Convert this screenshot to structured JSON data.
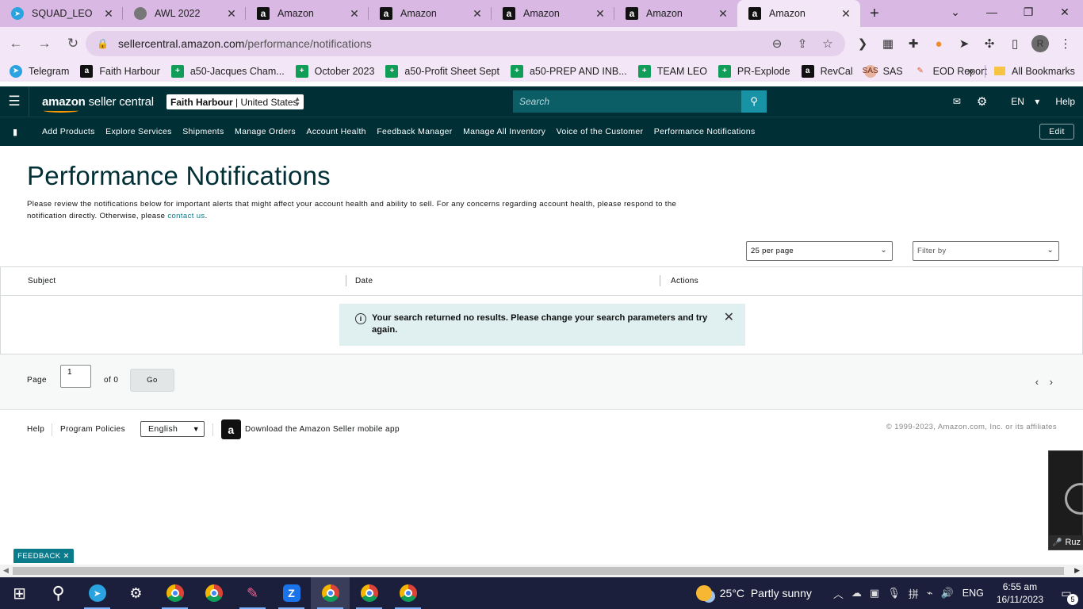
{
  "browser": {
    "tabs": [
      {
        "title": "SQUAD_LEO",
        "icon": "telegram-icon"
      },
      {
        "title": "AWL 2022",
        "icon": "globe-icon"
      },
      {
        "title": "Amazon",
        "icon": "amazon-icon"
      },
      {
        "title": "Amazon",
        "icon": "amazon-icon"
      },
      {
        "title": "Amazon",
        "icon": "amazon-icon"
      },
      {
        "title": "Amazon",
        "icon": "amazon-icon"
      },
      {
        "title": "Amazon",
        "icon": "amazon-icon",
        "active": true
      }
    ],
    "url_host": "sellercentral.amazon.com",
    "url_path": "/performance/notifications",
    "profile_initial": "R",
    "bookmarks": [
      {
        "label": "Telegram",
        "icon": "telegram"
      },
      {
        "label": "Faith Harbour",
        "icon": "amazon"
      },
      {
        "label": "a50-Jacques Cham...",
        "icon": "sheets"
      },
      {
        "label": "October 2023",
        "icon": "sheets"
      },
      {
        "label": "a50-Profit Sheet Sept",
        "icon": "sheets"
      },
      {
        "label": "a50-PREP AND INB...",
        "icon": "sheets"
      },
      {
        "label": "TEAM LEO",
        "icon": "sheets"
      },
      {
        "label": "PR-Explode",
        "icon": "sheets"
      },
      {
        "label": "RevCal",
        "icon": "amazon"
      },
      {
        "label": "SAS",
        "icon": "sas"
      },
      {
        "label": "EOD Report",
        "icon": "eod"
      }
    ],
    "all_bookmarks": "All Bookmarks"
  },
  "header": {
    "logo_main": "amazon",
    "logo_sub": "seller central",
    "account_name": "Faith Harbour",
    "account_market": "United States",
    "search_placeholder": "Search",
    "language": "EN",
    "help": "Help"
  },
  "nav": {
    "links": [
      "Add Products",
      "Explore Services",
      "Shipments",
      "Manage Orders",
      "Account Health",
      "Feedback Manager",
      "Manage All Inventory",
      "Voice of the Customer",
      "Performance Notifications"
    ],
    "edit": "Edit"
  },
  "page": {
    "title": "Performance Notifications",
    "intro": "Please review the notifications below for important alerts that might affect your account health and ability to sell. For any concerns regarding account health, please respond to the notification directly. Otherwise, please ",
    "contact_link": "contact us",
    "intro_end": ".",
    "per_page": "25 per page",
    "filter_placeholder": "Filter by",
    "columns": [
      "Subject",
      "Date",
      "Actions"
    ],
    "alert": "Your search returned no results. Please change your search parameters and try again.",
    "pager": {
      "page_label": "Page",
      "page_value": "1",
      "of_label": "of 0",
      "go": "Go"
    }
  },
  "footer": {
    "help": "Help",
    "program_policies": "Program Policies",
    "language": "English",
    "download_app": "Download the Amazon Seller mobile app",
    "copyright": "© 1999-2023, Amazon.com, Inc. or its affiliates"
  },
  "feedback": "FEEDBACK",
  "video": {
    "name": "Ruz"
  },
  "taskbar": {
    "weather_temp": "25°C",
    "weather_desc": "Partly sunny",
    "input_lang": "ENG",
    "time": "6:55 am",
    "date": "16/11/2023",
    "notifications_count": "5"
  }
}
